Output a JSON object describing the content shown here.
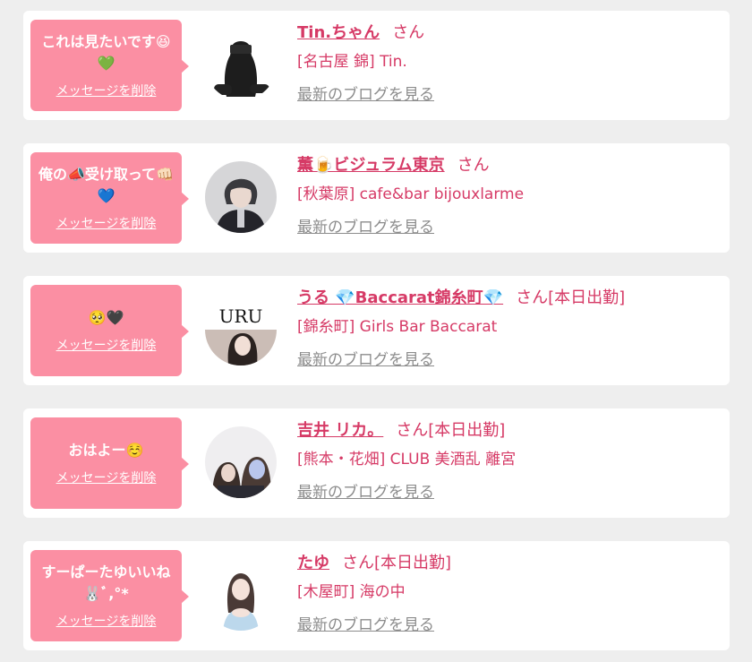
{
  "delete_label": "メッセージを削除",
  "blog_label": "最新のブログを見る",
  "honorific": "さん",
  "colors": {
    "bubble": "#fb8fa3",
    "accent": "#d63a66",
    "muted": "#8c8c8c",
    "background": "#eeeeee"
  },
  "messages": [
    {
      "bubble_text": "これは見たいです😆💚",
      "name": "Tin.ちゃん",
      "status": "",
      "work": "[名古屋 錦] Tin.",
      "avatar_icon": "avatar-photo"
    },
    {
      "bubble_text": "俺の📣受け取って👊🏻💙",
      "name": "薫🍺ビジュラム東京",
      "status": "",
      "work": "[秋葉原] cafe&bar bijouxlarme",
      "avatar_icon": "avatar-photo"
    },
    {
      "bubble_text": "🥺🖤",
      "name": "うる 💎Baccarat錦糸町💎",
      "status": "[本日出勤]",
      "work": "[錦糸町] Girls Bar Baccarat",
      "avatar_icon": "avatar-photo",
      "avatar_caption": "URU"
    },
    {
      "bubble_text": "おはよー☺️",
      "name": "吉井 リカ。",
      "status": "[本日出勤]",
      "work": "[熊本・花畑] CLUB 美酒乱 離宮",
      "avatar_icon": "avatar-photo"
    },
    {
      "bubble_text": "すーぱーたゆいいね🐰ﾞ,°*",
      "name": "たゆ",
      "status": "[本日出勤]",
      "work": "[木屋町] 海の中",
      "avatar_icon": "avatar-photo"
    }
  ]
}
